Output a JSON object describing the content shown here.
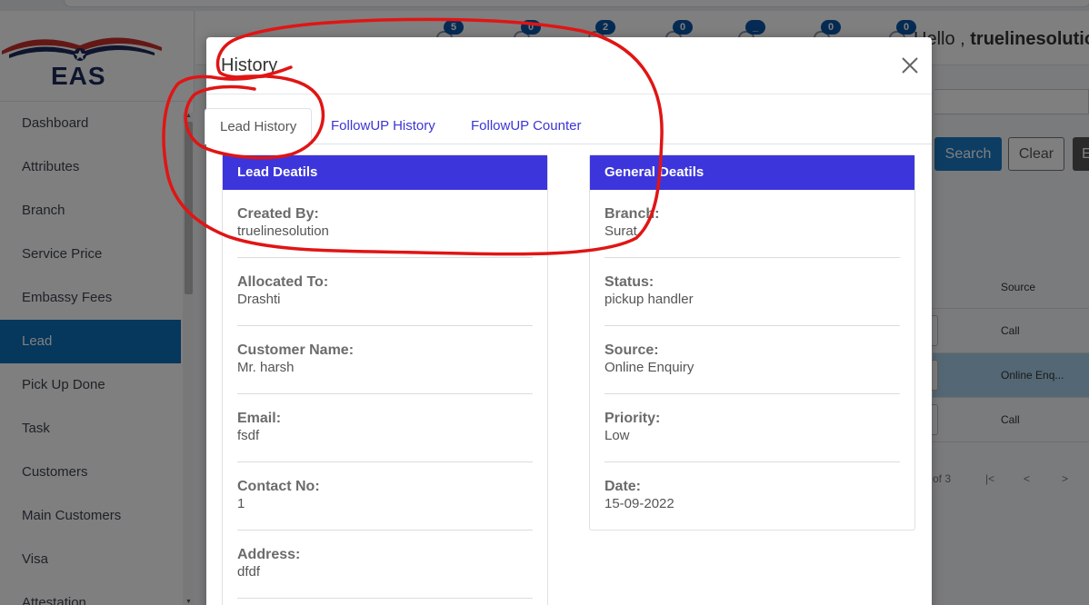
{
  "sidebar": {
    "logo_text": "EAS",
    "items": [
      {
        "label": "Dashboard"
      },
      {
        "label": "Attributes"
      },
      {
        "label": "Branch"
      },
      {
        "label": "Service Price"
      },
      {
        "label": "Embassy Fees"
      },
      {
        "label": "Lead",
        "active": true
      },
      {
        "label": "Pick Up Done"
      },
      {
        "label": "Task"
      },
      {
        "label": "Customers"
      },
      {
        "label": "Main Customers"
      },
      {
        "label": "Visa"
      },
      {
        "label": "Attestation"
      }
    ]
  },
  "header": {
    "notifications": [
      {
        "count": "5"
      },
      {
        "count": "0"
      },
      {
        "count": "2"
      },
      {
        "count": "0"
      },
      {
        "count": "_"
      },
      {
        "count": "0"
      },
      {
        "count": "0"
      }
    ],
    "greeting": "Hello , ",
    "username": "truelinesolution"
  },
  "background": {
    "search_label": "Search",
    "clear_label": "Clear",
    "other_label": "E",
    "table_header": "Source",
    "rows": [
      "Call",
      "Online Enq...",
      "Call"
    ],
    "pager_text": "of 3",
    "pager_first": "|<",
    "pager_prev": "<",
    "pager_next": ">"
  },
  "modal": {
    "title": "History",
    "tabs": [
      {
        "label": "Lead History",
        "active": true
      },
      {
        "label": "FollowUP History"
      },
      {
        "label": "FollowUP Counter"
      }
    ],
    "lead_card": {
      "title": "Lead Deatils",
      "fields": [
        {
          "label": "Created By:",
          "value": "truelinesolution"
        },
        {
          "label": "Allocated To:",
          "value": "Drashti"
        },
        {
          "label": "Customer Name:",
          "value": "Mr. harsh"
        },
        {
          "label": "Email:",
          "value": "fsdf"
        },
        {
          "label": "Contact No:",
          "value": "1"
        },
        {
          "label": "Address:",
          "value": "dfdf"
        }
      ]
    },
    "general_card": {
      "title": "General Deatils",
      "fields": [
        {
          "label": "Branch:",
          "value": "Surat"
        },
        {
          "label": "Status:",
          "value": "pickup handler"
        },
        {
          "label": "Source:",
          "value": "Online Enquiry"
        },
        {
          "label": "Priority:",
          "value": "Low"
        },
        {
          "label": "Date:",
          "value": "15-09-2022"
        }
      ]
    }
  },
  "colors": {
    "sidebar_active": "#0d6fb8",
    "card_header": "#3d35dc",
    "tab_link": "#3b35d6",
    "annotation": "#e01515"
  }
}
